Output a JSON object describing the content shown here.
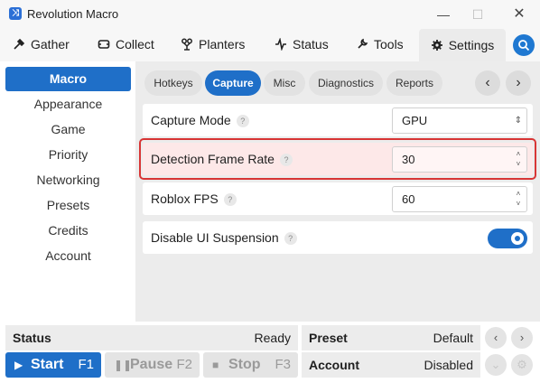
{
  "window": {
    "title": "Revolution Macro",
    "minimize_icon": "minimize-icon",
    "maximize_icon": "maximize-icon",
    "close_icon": "close-icon"
  },
  "topnav": {
    "tabs": [
      {
        "label": "Gather",
        "icon": "gather-icon"
      },
      {
        "label": "Collect",
        "icon": "collect-icon"
      },
      {
        "label": "Planters",
        "icon": "planters-icon"
      },
      {
        "label": "Status",
        "icon": "status-icon"
      },
      {
        "label": "Tools",
        "icon": "tools-icon"
      },
      {
        "label": "Settings",
        "icon": "gear-icon"
      }
    ],
    "active": "Settings",
    "search_icon": "search-icon"
  },
  "sidebar": {
    "items": [
      "Macro",
      "Appearance",
      "Game",
      "Priority",
      "Networking",
      "Presets",
      "Credits",
      "Account"
    ],
    "active": "Macro"
  },
  "subtabs": {
    "items": [
      "Hotkeys",
      "Capture",
      "Misc",
      "Diagnostics",
      "Reports"
    ],
    "active": "Capture"
  },
  "settings": [
    {
      "label": "Capture Mode",
      "value": "GPU",
      "type": "select"
    },
    {
      "label": "Detection Frame Rate",
      "value": "30",
      "type": "number",
      "highlighted": true
    },
    {
      "label": "Roblox FPS",
      "value": "60",
      "type": "number"
    },
    {
      "label": "Disable UI Suspension",
      "value": true,
      "type": "toggle"
    }
  ],
  "help_glyph": "?",
  "status_bar": {
    "status_label": "Status",
    "status_value": "Ready",
    "preset_label": "Preset",
    "preset_value": "Default",
    "account_label": "Account",
    "account_value": "Disabled"
  },
  "controls": {
    "start": {
      "label": "Start",
      "key": "F1"
    },
    "pause": {
      "label": "Pause",
      "key": "F2"
    },
    "stop": {
      "label": "Stop",
      "key": "F3"
    }
  },
  "colors": {
    "accent": "#1f6fc8",
    "highlight_border": "#d83535",
    "highlight_fill": "#fde8e8"
  }
}
